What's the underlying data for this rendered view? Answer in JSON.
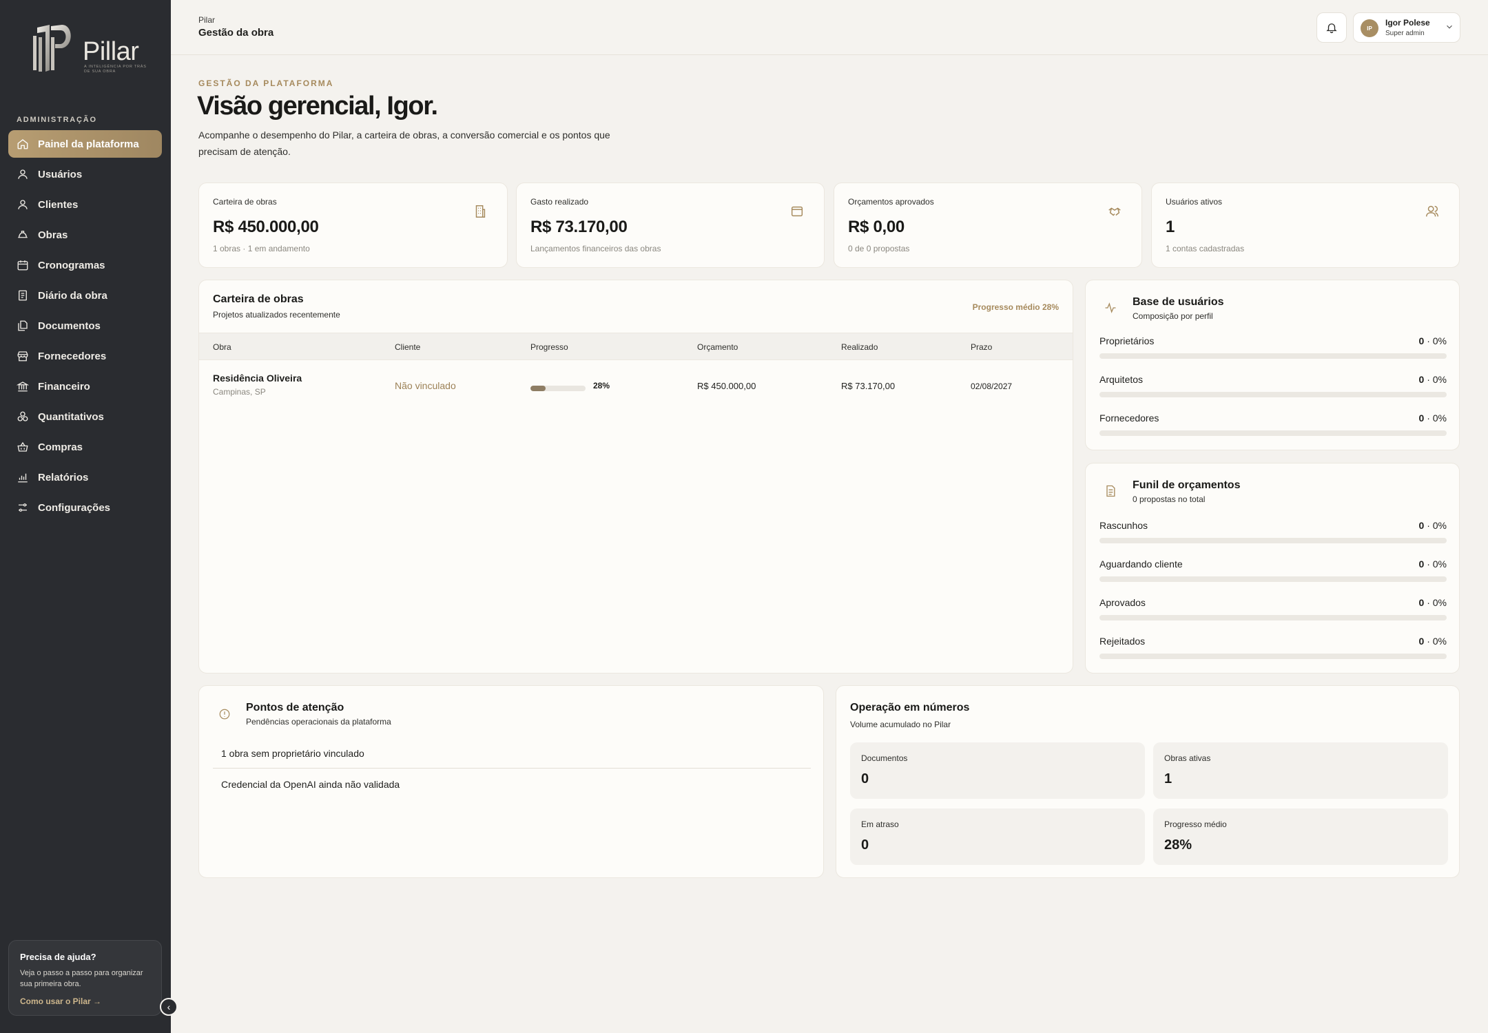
{
  "brand": {
    "name": "Pillar",
    "tagline": "A INTELIGÊNCIA POR TRÁS DE SUA OBRA"
  },
  "sidebar": {
    "section_label": "ADMINISTRAÇÃO",
    "items": [
      {
        "label": "Painel da plataforma",
        "icon": "home-icon",
        "active": true
      },
      {
        "label": "Usuários",
        "icon": "user-icon"
      },
      {
        "label": "Clientes",
        "icon": "user-icon"
      },
      {
        "label": "Obras",
        "icon": "helmet-icon"
      },
      {
        "label": "Cronogramas",
        "icon": "calendar-icon"
      },
      {
        "label": "Diário da obra",
        "icon": "journal-icon"
      },
      {
        "label": "Documentos",
        "icon": "documents-icon"
      },
      {
        "label": "Fornecedores",
        "icon": "store-icon"
      },
      {
        "label": "Financeiro",
        "icon": "bank-icon"
      },
      {
        "label": "Quantitativos",
        "icon": "blocks-icon"
      },
      {
        "label": "Compras",
        "icon": "basket-icon"
      },
      {
        "label": "Relatórios",
        "icon": "chart-icon"
      },
      {
        "label": "Configurações",
        "icon": "settings-icon"
      }
    ],
    "help": {
      "title": "Precisa de ajuda?",
      "text": "Veja o passo a passo para organizar sua primeira obra.",
      "link": "Como usar o Pilar →"
    }
  },
  "topbar": {
    "crumb_top": "Pilar",
    "crumb_main": "Gestão da obra",
    "user": {
      "initials": "IP",
      "name": "Igor Polese",
      "role": "Super admin"
    }
  },
  "header": {
    "eyebrow": "GESTÃO DA PLATAFORMA",
    "title": "Visão gerencial, Igor.",
    "description": "Acompanhe o desempenho do Pilar, a carteira de obras, a conversão comercial e os pontos que precisam de atenção."
  },
  "kpis": [
    {
      "label": "Carteira de obras",
      "value": "R$ 450.000,00",
      "sub": "1 obras · 1 em andamento",
      "icon": "building-icon"
    },
    {
      "label": "Gasto realizado",
      "value": "R$ 73.170,00",
      "sub": "Lançamentos financeiros das obras",
      "icon": "wallet-icon"
    },
    {
      "label": "Orçamentos aprovados",
      "value": "R$ 0,00",
      "sub": "0 de 0 propostas",
      "icon": "handshake-icon"
    },
    {
      "label": "Usuários ativos",
      "value": "1",
      "sub": "1 contas cadastradas",
      "icon": "users-icon"
    }
  ],
  "portfolio": {
    "title": "Carteira de obras",
    "subtitle": "Projetos atualizados recentemente",
    "average": "Progresso médio 28%",
    "columns": [
      "Obra",
      "Cliente",
      "Progresso",
      "Orçamento",
      "Realizado",
      "Prazo"
    ],
    "rows": [
      {
        "name": "Residência Oliveira",
        "location": "Campinas, SP",
        "client": "Não vinculado",
        "progress": 28,
        "progress_label": "28%",
        "budget": "R$ 450.000,00",
        "realized": "R$ 73.170,00",
        "deadline": "02/08/2027"
      }
    ]
  },
  "user_base": {
    "title": "Base de usuários",
    "subtitle": "Composição por perfil",
    "icon": "activity-icon",
    "items": [
      {
        "label": "Proprietários",
        "count": "0",
        "pct": "0%"
      },
      {
        "label": "Arquitetos",
        "count": "0",
        "pct": "0%"
      },
      {
        "label": "Fornecedores",
        "count": "0",
        "pct": "0%"
      }
    ]
  },
  "funnel": {
    "title": "Funil de orçamentos",
    "subtitle": "0 propostas no total",
    "icon": "document-icon",
    "items": [
      {
        "label": "Rascunhos",
        "count": "0",
        "pct": "0%"
      },
      {
        "label": "Aguardando cliente",
        "count": "0",
        "pct": "0%"
      },
      {
        "label": "Aprovados",
        "count": "0",
        "pct": "0%"
      },
      {
        "label": "Rejeitados",
        "count": "0",
        "pct": "0%"
      }
    ]
  },
  "attention": {
    "title": "Pontos de atenção",
    "subtitle": "Pendências operacionais da plataforma",
    "icon": "alert-icon",
    "items": [
      "1 obra sem proprietário vinculado",
      "Credencial da OpenAI ainda não validada"
    ]
  },
  "operations": {
    "title": "Operação em números",
    "subtitle": "Volume acumulado no Pilar",
    "tiles": [
      {
        "label": "Documentos",
        "value": "0"
      },
      {
        "label": "Obras ativas",
        "value": "1"
      },
      {
        "label": "Em atraso",
        "value": "0"
      },
      {
        "label": "Progresso médio",
        "value": "28%"
      }
    ]
  },
  "colors": {
    "accent": "#a68a5d",
    "sidebar": "#2a2c30",
    "background": "#f4f2ee"
  }
}
